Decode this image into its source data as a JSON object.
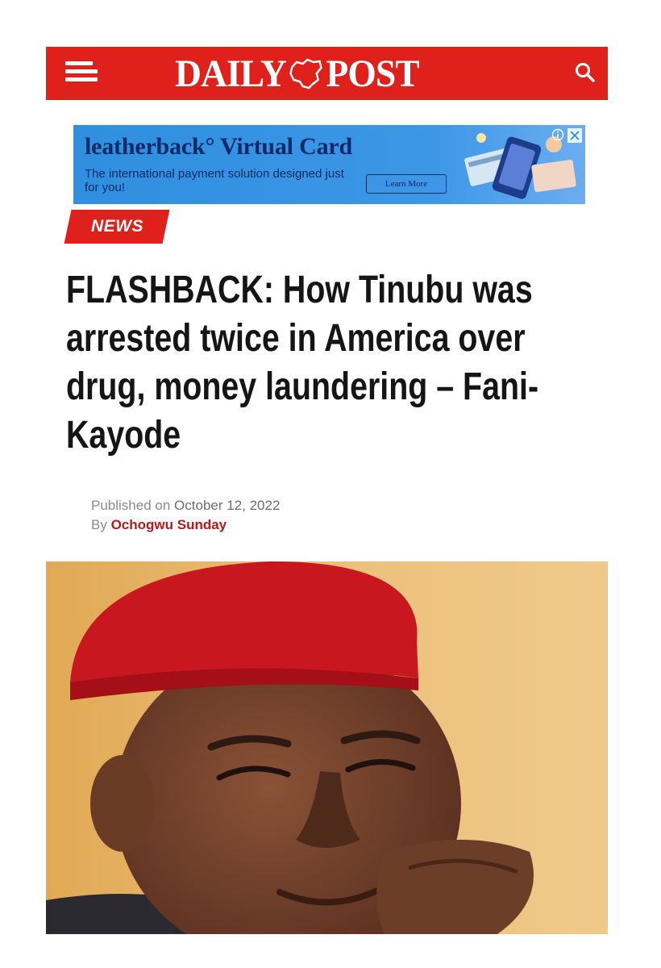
{
  "header": {
    "logo_left": "DAILY",
    "logo_right": "POST",
    "menu_icon": "hamburger-menu-icon",
    "search_icon": "search-icon",
    "brand_color": "#e0201b"
  },
  "ad": {
    "title": "leatherback° Virtual Card",
    "text": "The international payment solution designed just for you!",
    "button_label": "Learn More",
    "info_icon": "ad-info-icon",
    "close_icon": "close-icon",
    "background": "#3d96e6"
  },
  "article": {
    "category": "NEWS",
    "headline": "FLASHBACK: How Tinubu was arrested twice in America over drug, money laundering – Fani-Kayode",
    "published_prefix": "Published on",
    "published_date": "October 12, 2022",
    "by_prefix": "By",
    "author": "Ochogwu Sunday"
  }
}
